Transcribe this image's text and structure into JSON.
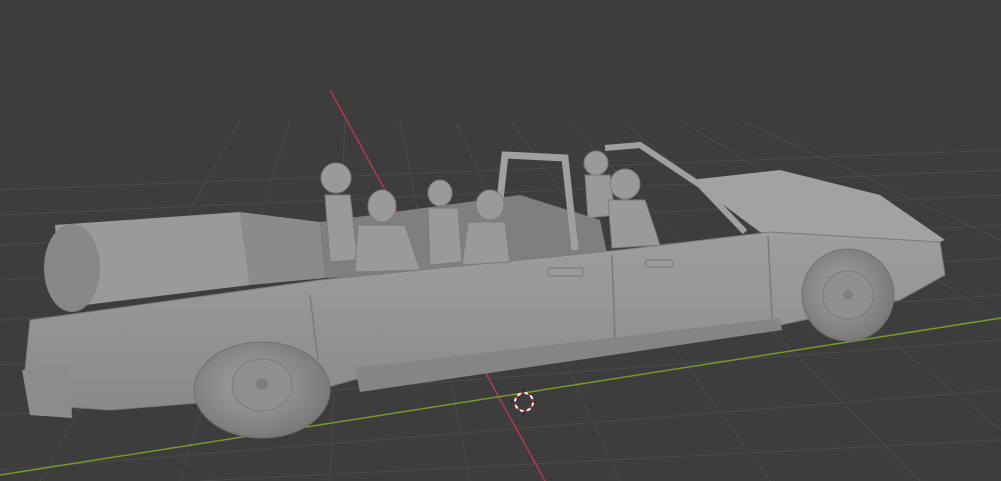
{
  "viewport": {
    "background": "#3d3d3d",
    "grid_color": "#4a4a4a",
    "x_axis_color": "#b43a4a",
    "y_axis_color": "#7a9a2a",
    "model_color": "#8f8f8f",
    "objects": [
      "car-model",
      "figures",
      "3d-cursor"
    ]
  }
}
